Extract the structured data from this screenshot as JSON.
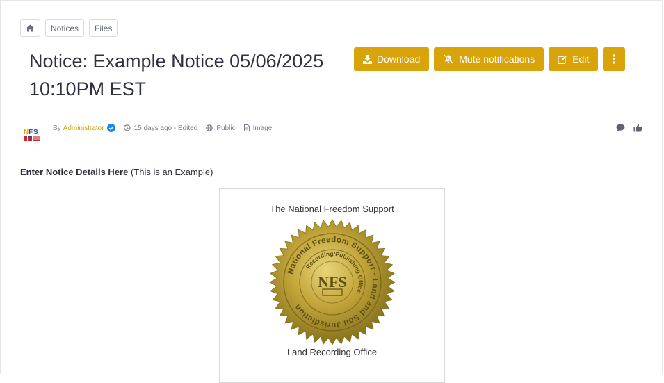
{
  "breadcrumb": {
    "home_icon": "home-icon",
    "items": [
      "Notices",
      "Files"
    ]
  },
  "page": {
    "title": "Notice: Example Notice 05/06/2025 10:10PM EST"
  },
  "actions": {
    "download": "Download",
    "mute": "Mute notifications",
    "edit": "Edit",
    "more_icon": "vertical-ellipsis-icon"
  },
  "meta": {
    "by": "By",
    "author": "Administrator",
    "time": "15 days ago - Edited",
    "visibility": "Public",
    "type": "Image"
  },
  "body": {
    "details_bold": "Enter Notice Details Here",
    "details_rest": " (This is an Example)"
  },
  "certificate": {
    "top_text": "The National Freedom Support",
    "bottom_text": "Land Recording Office",
    "seal_outer_text": "National Freedom Support · Land and Soil Jurisdiction",
    "seal_inner_text": "Recording/Publishing Office",
    "seal_center": "NFS"
  },
  "colors": {
    "accent": "#d9a30a",
    "verified": "#1e88e5",
    "seal_gold": "#b89a2a"
  }
}
